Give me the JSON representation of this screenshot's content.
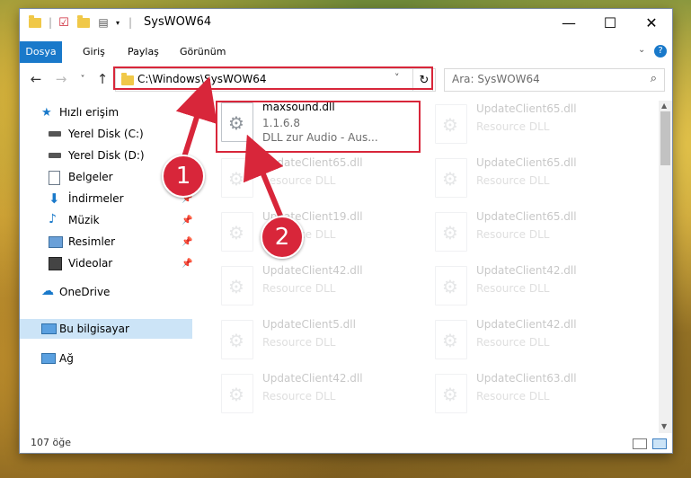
{
  "window": {
    "title": "SysWOW64",
    "controls": {
      "minimize": "—",
      "maximize": "☐",
      "close": "✕"
    }
  },
  "ribbon": {
    "tabs": [
      "Dosya",
      "Giriş",
      "Paylaş",
      "Görünüm"
    ],
    "collapse_icon": "chevron-down-icon",
    "help": "?"
  },
  "navigation": {
    "back": "←",
    "forward": "→",
    "recent": "˅",
    "up": "↑",
    "address": "C:\\Windows\\SysWOW64",
    "address_dropdown": "˅",
    "refresh": "↻",
    "search_placeholder": "Ara: SysWOW64",
    "search_icon": "⌕"
  },
  "sidebar": {
    "items": [
      {
        "label": "Hızlı erişim",
        "icon": "star-icon"
      },
      {
        "label": "Yerel Disk (C:)",
        "icon": "drive-icon"
      },
      {
        "label": "Yerel Disk (D:)",
        "icon": "drive-icon"
      },
      {
        "label": "Belgeler",
        "icon": "documents-icon"
      },
      {
        "label": "İndirmeler",
        "icon": "download-icon",
        "pin": "📌"
      },
      {
        "label": "Müzik",
        "icon": "music-icon",
        "pin": "📌"
      },
      {
        "label": "Resimler",
        "icon": "pictures-icon",
        "pin": "📌"
      },
      {
        "label": "Videolar",
        "icon": "videos-icon",
        "pin": "📌"
      },
      {
        "label": "OneDrive",
        "icon": "cloud-icon"
      },
      {
        "label": "Bu bilgisayar",
        "icon": "computer-icon",
        "selected": true
      },
      {
        "label": "Ağ",
        "icon": "network-icon"
      }
    ]
  },
  "files": {
    "highlighted": {
      "name": "maxsound.dll",
      "version": "1.1.6.8",
      "description": "DLL zur Audio - Aus..."
    },
    "left_column": [
      {
        "name": "UpdateClient65.dll",
        "desc": "Resource DLL"
      },
      {
        "name": "UpdateClient19.dll",
        "desc": "Resource DLL"
      },
      {
        "name": "UpdateClient42.dll",
        "desc": "Resource DLL"
      },
      {
        "name": "UpdateClient5.dll",
        "desc": "Resource DLL"
      },
      {
        "name": "UpdateClient42.dll",
        "desc": "Resource DLL"
      }
    ],
    "right_column": [
      {
        "name": "UpdateClient65.dll",
        "desc": "Resource DLL"
      },
      {
        "name": "UpdateClient65.dll",
        "desc": "Resource DLL"
      },
      {
        "name": "UpdateClient65.dll",
        "desc": "Resource DLL"
      },
      {
        "name": "UpdateClient42.dll",
        "desc": "Resource DLL"
      },
      {
        "name": "UpdateClient42.dll",
        "desc": "Resource DLL"
      },
      {
        "name": "UpdateClient63.dll",
        "desc": "Resource DLL"
      }
    ]
  },
  "status": {
    "item_count": "107 öğe"
  },
  "callouts": {
    "one": "1",
    "two": "2",
    "color": "#d8263a"
  }
}
